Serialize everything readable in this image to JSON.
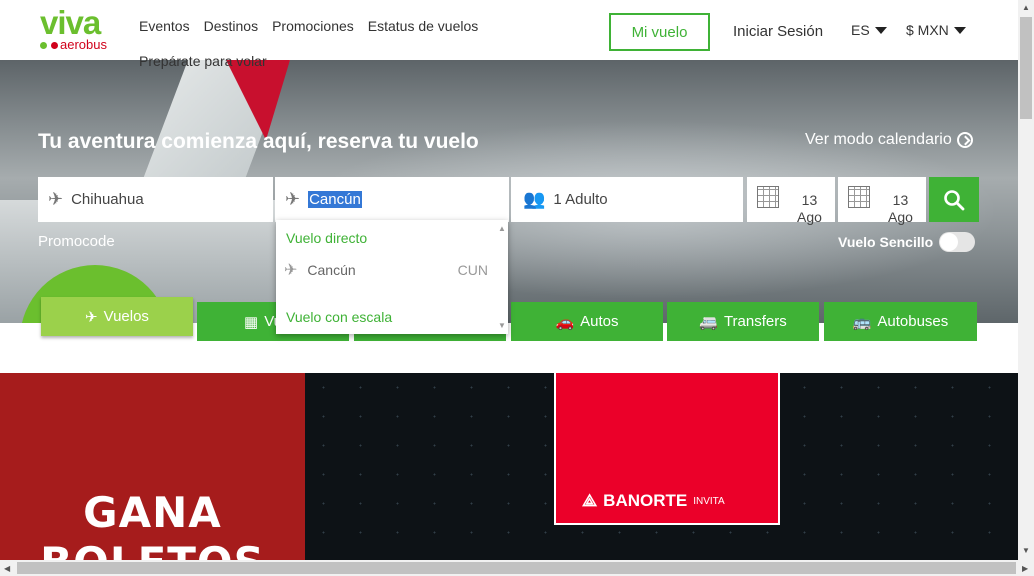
{
  "header": {
    "logo_main": "viva",
    "logo_sub": "aerobus",
    "nav": [
      "Eventos",
      "Destinos",
      "Promociones",
      "Estatus de vuelos"
    ],
    "nav_sub": "Prepárate para volar",
    "my_flight": "Mi vuelo",
    "login": "Iniciar Sesión",
    "language": "ES",
    "currency": "$ MXN"
  },
  "hero": {
    "title": "Tu aventura comienza aquí, reserva tu vuelo",
    "calendar_link": "Ver modo calendario",
    "origin": "Chihuahua",
    "destination": "Cancún",
    "passengers": "1 Adulto",
    "date_depart_day": "13",
    "date_depart_month": "Ago",
    "date_return_day": "13",
    "date_return_month": "Ago",
    "promocode": "Promocode",
    "one_way": "Vuelo Sencillo"
  },
  "dropdown": {
    "direct_header": "Vuelo directo",
    "items": [
      {
        "city": "Cancún",
        "code": "CUN"
      }
    ],
    "connecting_header": "Vuelo con escala"
  },
  "tabs": [
    {
      "label": "Vuelos",
      "icon": "plane-icon"
    },
    {
      "label": "Vuelo",
      "icon": "hotel-icon"
    },
    {
      "label": "",
      "icon": ""
    },
    {
      "label": "Autos",
      "icon": "car-icon"
    },
    {
      "label": "Transfers",
      "icon": "van-icon"
    },
    {
      "label": "Autobuses",
      "icon": "bus-icon"
    }
  ],
  "banner": {
    "title": "GANA BOLETOS",
    "banorte": "BANORTE",
    "banorte_invite": "INVITA"
  },
  "colors": {
    "brand_green": "#3fb236",
    "active_tab": "#9bd14b",
    "banner_red": "#a61c1c",
    "banorte_red": "#eb0029"
  }
}
